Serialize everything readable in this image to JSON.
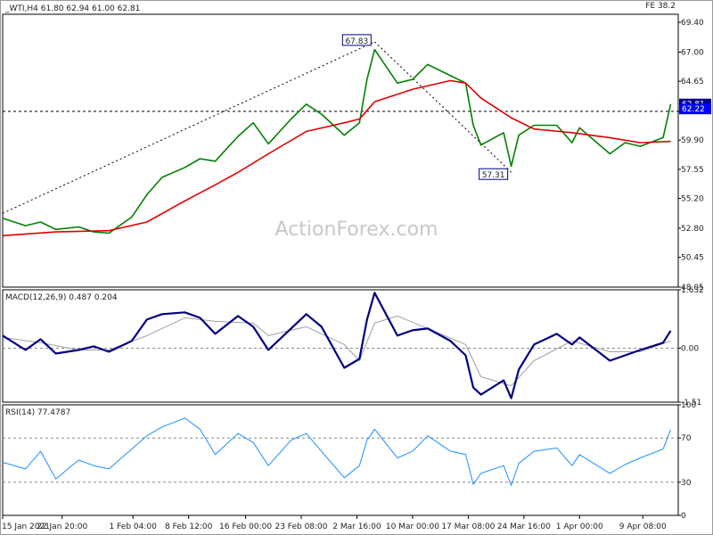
{
  "header": {
    "symbol_line": "_WTI,H4  61.80 62.94 61.00 62.81",
    "fe_label": "FE 38.2"
  },
  "watermark": "ActionForex.com",
  "colors": {
    "price": "#008000",
    "ema": "#e00000",
    "macd": "#000080",
    "signal": "#a0a0a0",
    "rsi": "#1e90ff",
    "price_tag_last": "#00008b",
    "price_tag_ref": "#0000ff"
  },
  "chart_data": [
    {
      "type": "line",
      "name": "price",
      "title": "",
      "ylim": [
        48.05,
        70.05
      ],
      "yticks": [
        "69.40",
        "67.00",
        "64.65",
        "62.22",
        "59.90",
        "57.55",
        "55.20",
        "52.80",
        "50.45",
        "48.05"
      ],
      "ytick_values": [
        69.4,
        67.0,
        64.65,
        62.22,
        59.9,
        57.55,
        55.2,
        52.8,
        50.45,
        48.05
      ],
      "last_price": "62.81",
      "ref_price": "62.22",
      "ref_line_value": 62.22,
      "annotations": [
        {
          "label": "67.83",
          "value": 67.83,
          "date": "5 Mar 2021"
        },
        {
          "label": "57.31",
          "value": 57.31,
          "date": "23 Mar 2021"
        }
      ],
      "close_points": [
        {
          "x": "15 Jan 2021",
          "y": 53.6
        },
        {
          "x": "18 Jan 2021",
          "y": 53.0
        },
        {
          "x": "20 Jan 2021",
          "y": 53.3
        },
        {
          "x": "22 Jan 2021",
          "y": 52.7
        },
        {
          "x": "25 Jan 2021",
          "y": 52.9
        },
        {
          "x": "27 Jan 2021",
          "y": 52.5
        },
        {
          "x": "29 Jan 2021",
          "y": 52.4
        },
        {
          "x": "1 Feb 2021",
          "y": 53.7
        },
        {
          "x": "3 Feb 2021",
          "y": 55.5
        },
        {
          "x": "5 Feb 2021",
          "y": 56.9
        },
        {
          "x": "8 Feb 2021",
          "y": 57.7
        },
        {
          "x": "10 Feb 2021",
          "y": 58.4
        },
        {
          "x": "12 Feb 2021",
          "y": 58.2
        },
        {
          "x": "15 Feb 2021",
          "y": 60.2
        },
        {
          "x": "17 Feb 2021",
          "y": 61.3
        },
        {
          "x": "19 Feb 2021",
          "y": 59.6
        },
        {
          "x": "22 Feb 2021",
          "y": 61.6
        },
        {
          "x": "24 Feb 2021",
          "y": 62.8
        },
        {
          "x": "26 Feb 2021",
          "y": 62.0
        },
        {
          "x": "1 Mar 2021",
          "y": 60.3
        },
        {
          "x": "3 Mar 2021",
          "y": 61.3
        },
        {
          "x": "4 Mar 2021",
          "y": 64.8
        },
        {
          "x": "5 Mar 2021",
          "y": 67.2
        },
        {
          "x": "8 Mar 2021",
          "y": 64.5
        },
        {
          "x": "10 Mar 2021",
          "y": 64.8
        },
        {
          "x": "12 Mar 2021",
          "y": 66.0
        },
        {
          "x": "15 Mar 2021",
          "y": 65.1
        },
        {
          "x": "17 Mar 2021",
          "y": 64.5
        },
        {
          "x": "18 Mar 2021",
          "y": 61.1
        },
        {
          "x": "19 Mar 2021",
          "y": 59.5
        },
        {
          "x": "22 Mar 2021",
          "y": 60.5
        },
        {
          "x": "23 Mar 2021",
          "y": 57.8
        },
        {
          "x": "24 Mar 2021",
          "y": 60.3
        },
        {
          "x": "26 Mar 2021",
          "y": 61.1
        },
        {
          "x": "29 Mar 2021",
          "y": 61.1
        },
        {
          "x": "31 Mar 2021",
          "y": 59.7
        },
        {
          "x": "1 Apr 2021",
          "y": 60.9
        },
        {
          "x": "5 Apr 2021",
          "y": 58.8
        },
        {
          "x": "7 Apr 2021",
          "y": 59.7
        },
        {
          "x": "9 Apr 2021",
          "y": 59.4
        },
        {
          "x": "12 Apr 2021",
          "y": 60.1
        },
        {
          "x": "13 Apr 2021",
          "y": 62.8
        }
      ],
      "ema_points": [
        {
          "x": "15 Jan 2021",
          "y": 52.2
        },
        {
          "x": "22 Jan 2021",
          "y": 52.5
        },
        {
          "x": "29 Jan 2021",
          "y": 52.6
        },
        {
          "x": "3 Feb 2021",
          "y": 53.3
        },
        {
          "x": "8 Feb 2021",
          "y": 55.0
        },
        {
          "x": "12 Feb 2021",
          "y": 56.3
        },
        {
          "x": "15 Feb 2021",
          "y": 57.3
        },
        {
          "x": "19 Feb 2021",
          "y": 58.8
        },
        {
          "x": "24 Feb 2021",
          "y": 60.6
        },
        {
          "x": "1 Mar 2021",
          "y": 61.3
        },
        {
          "x": "3 Mar 2021",
          "y": 61.6
        },
        {
          "x": "5 Mar 2021",
          "y": 63.0
        },
        {
          "x": "10 Mar 2021",
          "y": 64.0
        },
        {
          "x": "15 Mar 2021",
          "y": 64.7
        },
        {
          "x": "17 Mar 2021",
          "y": 64.5
        },
        {
          "x": "19 Mar 2021",
          "y": 63.3
        },
        {
          "x": "23 Mar 2021",
          "y": 61.7
        },
        {
          "x": "26 Mar 2021",
          "y": 60.8
        },
        {
          "x": "31 Mar 2021",
          "y": 60.5
        },
        {
          "x": "5 Apr 2021",
          "y": 60.1
        },
        {
          "x": "9 Apr 2021",
          "y": 59.7
        },
        {
          "x": "13 Apr 2021",
          "y": 59.8
        }
      ],
      "fib_lines": [
        {
          "from": {
            "x": "15 Jan 2021",
            "y": 54.0
          },
          "to": {
            "x": "5 Mar 2021",
            "y": 67.83
          }
        },
        {
          "from": {
            "x": "5 Mar 2021",
            "y": 67.83
          },
          "to": {
            "x": "23 Mar 2021",
            "y": 57.31
          }
        }
      ]
    },
    {
      "type": "line",
      "name": "macd",
      "title": "MACD(12,26,9) 0.487 0.204",
      "ylim": [
        -1.51,
        1.632
      ],
      "yticks": [
        "1.632",
        "0.00",
        "-1.51"
      ],
      "ytick_values": [
        1.632,
        0.0,
        -1.51
      ],
      "series": [
        {
          "name": "MACD",
          "values": [
            {
              "x": "15 Jan 2021",
              "y": 0.35
            },
            {
              "x": "18 Jan 2021",
              "y": -0.05
            },
            {
              "x": "20 Jan 2021",
              "y": 0.25
            },
            {
              "x": "22 Jan 2021",
              "y": -0.15
            },
            {
              "x": "25 Jan 2021",
              "y": -0.05
            },
            {
              "x": "27 Jan 2021",
              "y": 0.05
            },
            {
              "x": "29 Jan 2021",
              "y": -0.1
            },
            {
              "x": "1 Feb 2021",
              "y": 0.2
            },
            {
              "x": "3 Feb 2021",
              "y": 0.8
            },
            {
              "x": "5 Feb 2021",
              "y": 0.95
            },
            {
              "x": "8 Feb 2021",
              "y": 1.0
            },
            {
              "x": "10 Feb 2021",
              "y": 0.85
            },
            {
              "x": "12 Feb 2021",
              "y": 0.4
            },
            {
              "x": "15 Feb 2021",
              "y": 0.9
            },
            {
              "x": "17 Feb 2021",
              "y": 0.6
            },
            {
              "x": "19 Feb 2021",
              "y": -0.05
            },
            {
              "x": "22 Feb 2021",
              "y": 0.55
            },
            {
              "x": "24 Feb 2021",
              "y": 0.95
            },
            {
              "x": "26 Feb 2021",
              "y": 0.6
            },
            {
              "x": "1 Mar 2021",
              "y": -0.55
            },
            {
              "x": "3 Mar 2021",
              "y": -0.3
            },
            {
              "x": "4 Mar 2021",
              "y": 0.8
            },
            {
              "x": "5 Mar 2021",
              "y": 1.55
            },
            {
              "x": "8 Mar 2021",
              "y": 0.35
            },
            {
              "x": "10 Mar 2021",
              "y": 0.5
            },
            {
              "x": "12 Mar 2021",
              "y": 0.55
            },
            {
              "x": "15 Mar 2021",
              "y": 0.2
            },
            {
              "x": "17 Mar 2021",
              "y": -0.2
            },
            {
              "x": "18 Mar 2021",
              "y": -1.1
            },
            {
              "x": "19 Mar 2021",
              "y": -1.3
            },
            {
              "x": "22 Mar 2021",
              "y": -0.9
            },
            {
              "x": "23 Mar 2021",
              "y": -1.4
            },
            {
              "x": "24 Mar 2021",
              "y": -0.6
            },
            {
              "x": "26 Mar 2021",
              "y": 0.1
            },
            {
              "x": "29 Mar 2021",
              "y": 0.4
            },
            {
              "x": "31 Mar 2021",
              "y": 0.1
            },
            {
              "x": "1 Apr 2021",
              "y": 0.3
            },
            {
              "x": "5 Apr 2021",
              "y": -0.35
            },
            {
              "x": "7 Apr 2021",
              "y": -0.2
            },
            {
              "x": "9 Apr 2021",
              "y": -0.05
            },
            {
              "x": "12 Apr 2021",
              "y": 0.15
            },
            {
              "x": "13 Apr 2021",
              "y": 0.487
            }
          ]
        },
        {
          "name": "Signal",
          "values": [
            {
              "x": "15 Jan 2021",
              "y": 0.3
            },
            {
              "x": "20 Jan 2021",
              "y": 0.15
            },
            {
              "x": "25 Jan 2021",
              "y": -0.05
            },
            {
              "x": "29 Jan 2021",
              "y": -0.05
            },
            {
              "x": "3 Feb 2021",
              "y": 0.35
            },
            {
              "x": "8 Feb 2021",
              "y": 0.85
            },
            {
              "x": "12 Feb 2021",
              "y": 0.75
            },
            {
              "x": "17 Feb 2021",
              "y": 0.7
            },
            {
              "x": "19 Feb 2021",
              "y": 0.35
            },
            {
              "x": "24 Feb 2021",
              "y": 0.6
            },
            {
              "x": "1 Mar 2021",
              "y": 0.1
            },
            {
              "x": "3 Mar 2021",
              "y": -0.35
            },
            {
              "x": "5 Mar 2021",
              "y": 0.7
            },
            {
              "x": "8 Mar 2021",
              "y": 0.9
            },
            {
              "x": "12 Mar 2021",
              "y": 0.55
            },
            {
              "x": "17 Mar 2021",
              "y": 0.1
            },
            {
              "x": "19 Mar 2021",
              "y": -0.8
            },
            {
              "x": "23 Mar 2021",
              "y": -1.05
            },
            {
              "x": "26 Mar 2021",
              "y": -0.35
            },
            {
              "x": "31 Mar 2021",
              "y": 0.2
            },
            {
              "x": "5 Apr 2021",
              "y": -0.1
            },
            {
              "x": "9 Apr 2021",
              "y": -0.1
            },
            {
              "x": "13 Apr 2021",
              "y": 0.204
            }
          ]
        }
      ]
    },
    {
      "type": "line",
      "name": "rsi",
      "title": "RSI(14) 77.4787",
      "ylim": [
        0,
        100
      ],
      "yticks": [
        "100",
        "70",
        "30",
        "0"
      ],
      "ytick_values": [
        100,
        70,
        30,
        0
      ],
      "reference_lines": [
        70,
        30
      ],
      "series": [
        {
          "name": "RSI",
          "values": [
            {
              "x": "15 Jan 2021",
              "y": 48
            },
            {
              "x": "18 Jan 2021",
              "y": 42
            },
            {
              "x": "20 Jan 2021",
              "y": 58
            },
            {
              "x": "22 Jan 2021",
              "y": 33
            },
            {
              "x": "25 Jan 2021",
              "y": 50
            },
            {
              "x": "27 Jan 2021",
              "y": 45
            },
            {
              "x": "29 Jan 2021",
              "y": 42
            },
            {
              "x": "1 Feb 2021",
              "y": 60
            },
            {
              "x": "3 Feb 2021",
              "y": 72
            },
            {
              "x": "5 Feb 2021",
              "y": 80
            },
            {
              "x": "8 Feb 2021",
              "y": 88
            },
            {
              "x": "10 Feb 2021",
              "y": 78
            },
            {
              "x": "12 Feb 2021",
              "y": 55
            },
            {
              "x": "15 Feb 2021",
              "y": 74
            },
            {
              "x": "17 Feb 2021",
              "y": 66
            },
            {
              "x": "19 Feb 2021",
              "y": 45
            },
            {
              "x": "22 Feb 2021",
              "y": 68
            },
            {
              "x": "24 Feb 2021",
              "y": 74
            },
            {
              "x": "26 Feb 2021",
              "y": 58
            },
            {
              "x": "1 Mar 2021",
              "y": 34
            },
            {
              "x": "3 Mar 2021",
              "y": 45
            },
            {
              "x": "4 Mar 2021",
              "y": 68
            },
            {
              "x": "5 Mar 2021",
              "y": 78
            },
            {
              "x": "8 Mar 2021",
              "y": 52
            },
            {
              "x": "10 Mar 2021",
              "y": 58
            },
            {
              "x": "12 Mar 2021",
              "y": 72
            },
            {
              "x": "15 Mar 2021",
              "y": 58
            },
            {
              "x": "17 Mar 2021",
              "y": 55
            },
            {
              "x": "18 Mar 2021",
              "y": 28
            },
            {
              "x": "19 Mar 2021",
              "y": 38
            },
            {
              "x": "22 Mar 2021",
              "y": 45
            },
            {
              "x": "23 Mar 2021",
              "y": 27
            },
            {
              "x": "24 Mar 2021",
              "y": 47
            },
            {
              "x": "26 Mar 2021",
              "y": 58
            },
            {
              "x": "29 Mar 2021",
              "y": 61
            },
            {
              "x": "31 Mar 2021",
              "y": 45
            },
            {
              "x": "1 Apr 2021",
              "y": 55
            },
            {
              "x": "5 Apr 2021",
              "y": 38
            },
            {
              "x": "7 Apr 2021",
              "y": 46
            },
            {
              "x": "9 Apr 2021",
              "y": 52
            },
            {
              "x": "12 Apr 2021",
              "y": 60
            },
            {
              "x": "13 Apr 2021",
              "y": 77.4787
            }
          ]
        }
      ]
    }
  ],
  "x_axis": {
    "range": [
      "15 Jan 2021",
      "14 Apr 2021"
    ],
    "ticks": [
      {
        "label": "15 Jan 2021",
        "x": "15 Jan 2021"
      },
      {
        "label": "22 Jan 20:00",
        "x": "22 Jan 2021 20:00"
      },
      {
        "label": "1 Feb 04:00",
        "x": "1 Feb 2021 04:00"
      },
      {
        "label": "8 Feb 12:00",
        "x": "8 Feb 2021 12:00"
      },
      {
        "label": "16 Feb 00:00",
        "x": "16 Feb 2021 00:00"
      },
      {
        "label": "23 Feb 08:00",
        "x": "23 Feb 2021 08:00"
      },
      {
        "label": "2 Mar 16:00",
        "x": "2 Mar 2021 16:00"
      },
      {
        "label": "10 Mar 00:00",
        "x": "10 Mar 2021 00:00"
      },
      {
        "label": "17 Mar 08:00",
        "x": "17 Mar 2021 08:00"
      },
      {
        "label": "24 Mar 16:00",
        "x": "24 Mar 2021 16:00"
      },
      {
        "label": "1 Apr 00:00",
        "x": "1 Apr 2021 00:00"
      },
      {
        "label": "9 Apr 08:00",
        "x": "9 Apr 2021 08:00"
      }
    ]
  }
}
